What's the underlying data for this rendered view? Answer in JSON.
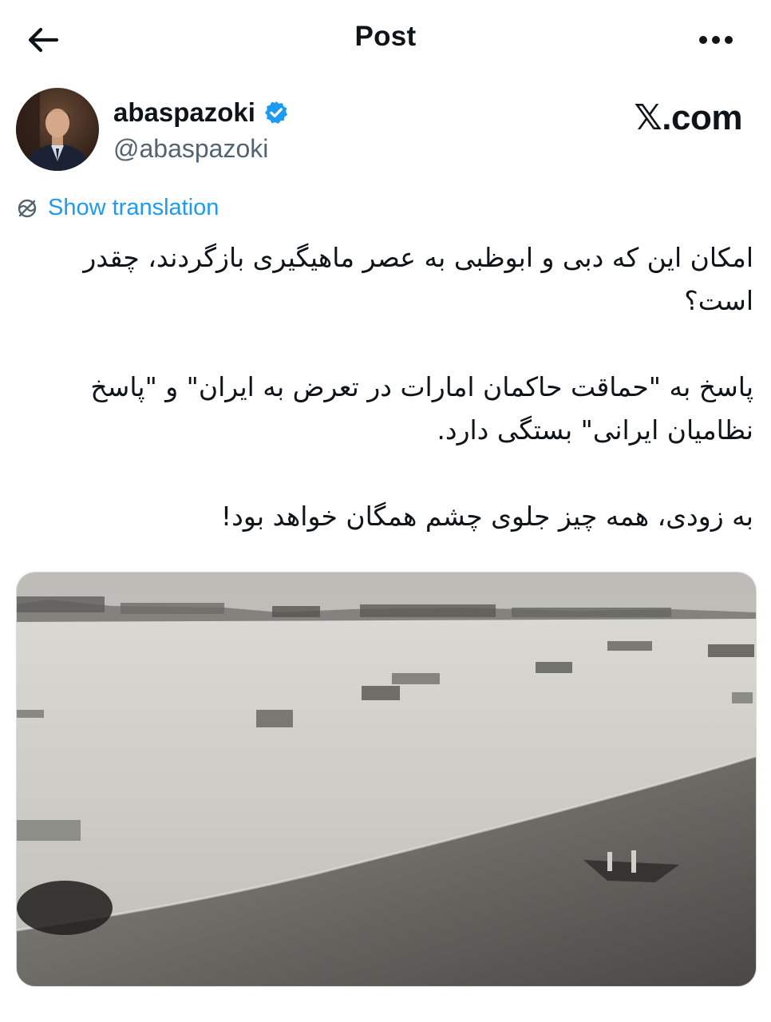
{
  "header": {
    "title": "Post",
    "back_icon": "arrow-left-icon",
    "more_icon": "more-horizontal-icon"
  },
  "author": {
    "name": "abaspazoki",
    "handle": "@abaspazoki",
    "verified": true,
    "verified_color": "#1d9bf0"
  },
  "watermark": {
    "text": ".com",
    "logo": "𝕏"
  },
  "translation": {
    "label": "Show translation",
    "icon": "translate-globe-icon",
    "color": "#1d9bf0"
  },
  "post": {
    "paragraphs": [
      "امکان این که دبی و ابوظبی به عصر ماهیگیری بازگردند، چقدر است؟",
      "پاسخ به \"حماقت حاکمان امارات در تعرض به ایران\" و \"پاسخ نظامیان ایرانی\" بستگی دارد.",
      "به زودی، همه چیز جلوی چشم همگان خواهد بود!"
    ]
  },
  "media": {
    "type": "black-and-white historical photo of a coastal fishing settlement"
  }
}
